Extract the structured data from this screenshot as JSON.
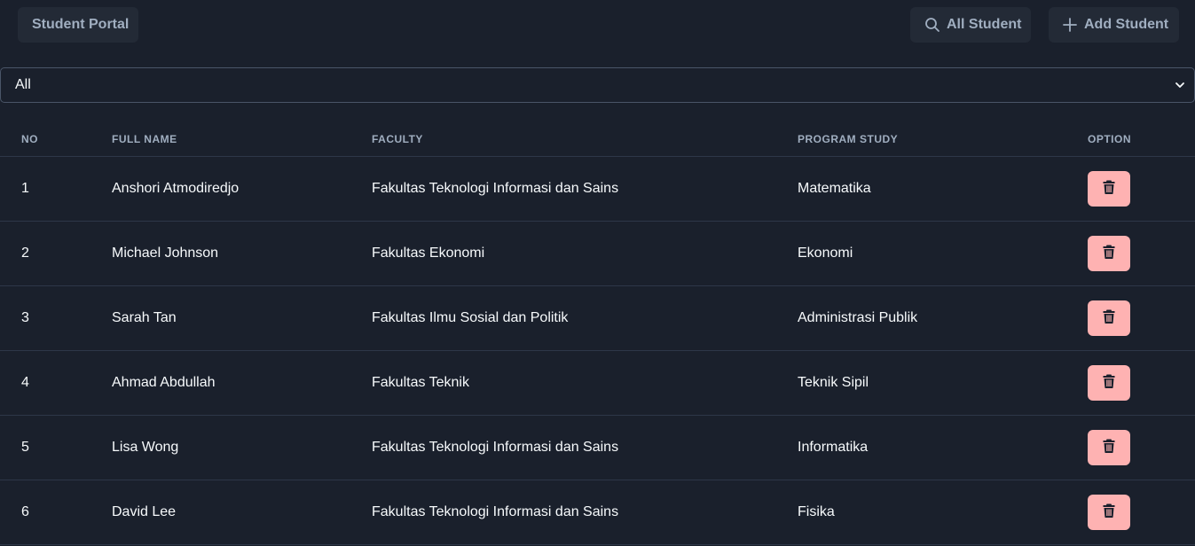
{
  "header": {
    "brand": "Student Portal",
    "search_label": "All Student",
    "add_label": "Add Student",
    "search_icon": "search-icon",
    "add_icon": "plus-icon"
  },
  "filter": {
    "selected": "All",
    "chevron_icon": "chevron-down-icon"
  },
  "table": {
    "columns": [
      "NO",
      "FULL NAME",
      "FACULTY",
      "PROGRAM STUDY",
      "OPTION"
    ],
    "rows": [
      {
        "no": "1",
        "name": "Anshori Atmodiredjo",
        "faculty": "Fakultas Teknologi Informasi dan Sains",
        "program": "Matematika"
      },
      {
        "no": "2",
        "name": "Michael Johnson",
        "faculty": "Fakultas Ekonomi",
        "program": "Ekonomi"
      },
      {
        "no": "3",
        "name": "Sarah Tan",
        "faculty": "Fakultas Ilmu Sosial dan Politik",
        "program": "Administrasi Publik"
      },
      {
        "no": "4",
        "name": "Ahmad Abdullah",
        "faculty": "Fakultas Teknik",
        "program": "Teknik Sipil"
      },
      {
        "no": "5",
        "name": "Lisa Wong",
        "faculty": "Fakultas Teknologi Informasi dan Sains",
        "program": "Informatika"
      },
      {
        "no": "6",
        "name": "David Lee",
        "faculty": "Fakultas Teknologi Informasi dan Sains",
        "program": "Fisika"
      }
    ],
    "delete_icon": "trash-icon"
  },
  "colors": {
    "background": "#1a202c",
    "button_dark": "#232a36",
    "delete_button": "#feb2b2",
    "header_text": "#a0aec0",
    "row_border": "#2d3748"
  }
}
